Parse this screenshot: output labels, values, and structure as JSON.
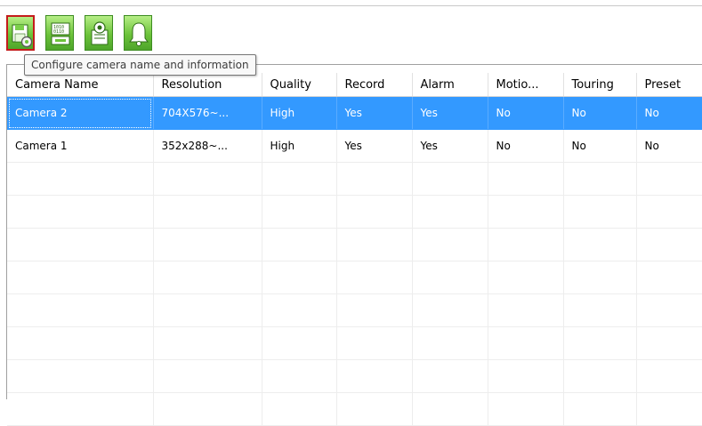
{
  "toolbar": {
    "buttons": [
      {
        "name": "camera-config-button",
        "icon": "save-gear-icon",
        "selected": true
      },
      {
        "name": "binary-data-button",
        "icon": "binary-data-icon",
        "selected": false
      },
      {
        "name": "camera-record-button",
        "icon": "camera-document-icon",
        "selected": false
      },
      {
        "name": "alarm-button",
        "icon": "bell-icon",
        "selected": false
      }
    ]
  },
  "tooltip": {
    "text": "Configure camera name and information"
  },
  "table": {
    "columns": [
      "Camera Name",
      "Resolution",
      "Quality",
      "Record",
      "Alarm",
      "Motio...",
      "Touring",
      "Preset"
    ],
    "rows": [
      {
        "selected": true,
        "cells": [
          "Camera 2",
          "704X576~...",
          "High",
          "Yes",
          "Yes",
          "No",
          "No",
          "No"
        ]
      },
      {
        "selected": false,
        "cells": [
          "Camera 1",
          "352x288~...",
          "High",
          "Yes",
          "Yes",
          "No",
          "No",
          "No"
        ]
      }
    ]
  },
  "colors": {
    "selection": "#3399ff",
    "toolbar_green": "#6cc33a",
    "selected_button_border": "#c41b1b"
  }
}
